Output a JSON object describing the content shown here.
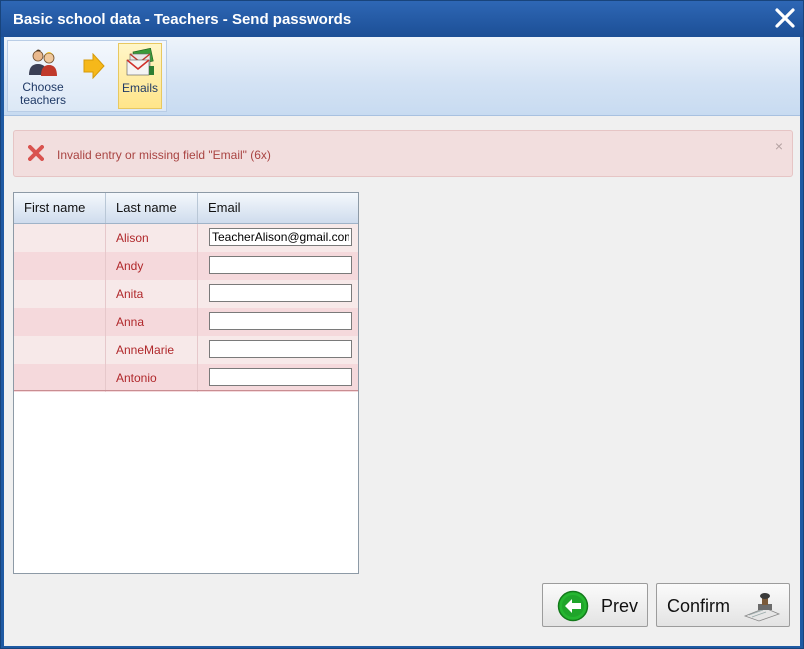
{
  "window": {
    "title": "Basic school data - Teachers - Send passwords"
  },
  "toolbar": {
    "steps": [
      {
        "label_line1": "Choose",
        "label_line2": "teachers",
        "icon": "teachers-icon"
      },
      {
        "label": "Emails",
        "icon": "emails-icon",
        "active": true
      }
    ],
    "arrow_icon": "arrow-right-icon"
  },
  "alert": {
    "message": "Invalid entry or missing field \"Email\" (6x)",
    "close": "×",
    "icon": "error-x-icon"
  },
  "grid": {
    "columns": [
      "First name",
      "Last name",
      "Email"
    ],
    "rows": [
      {
        "first": "",
        "last": "Alison",
        "email": "TeacherAlison@gmail.com"
      },
      {
        "first": "",
        "last": "Andy",
        "email": ""
      },
      {
        "first": "",
        "last": "Anita",
        "email": ""
      },
      {
        "first": "",
        "last": "Anna",
        "email": ""
      },
      {
        "first": "",
        "last": "AnneMarie",
        "email": ""
      },
      {
        "first": "",
        "last": "Antonio",
        "email": ""
      }
    ]
  },
  "buttons": {
    "prev": "Prev",
    "confirm": "Confirm"
  },
  "colors": {
    "title_bar": "#1f5aa3",
    "error_text": "#a94442",
    "error_bg": "#f2dede",
    "row_text": "#b0282b"
  }
}
